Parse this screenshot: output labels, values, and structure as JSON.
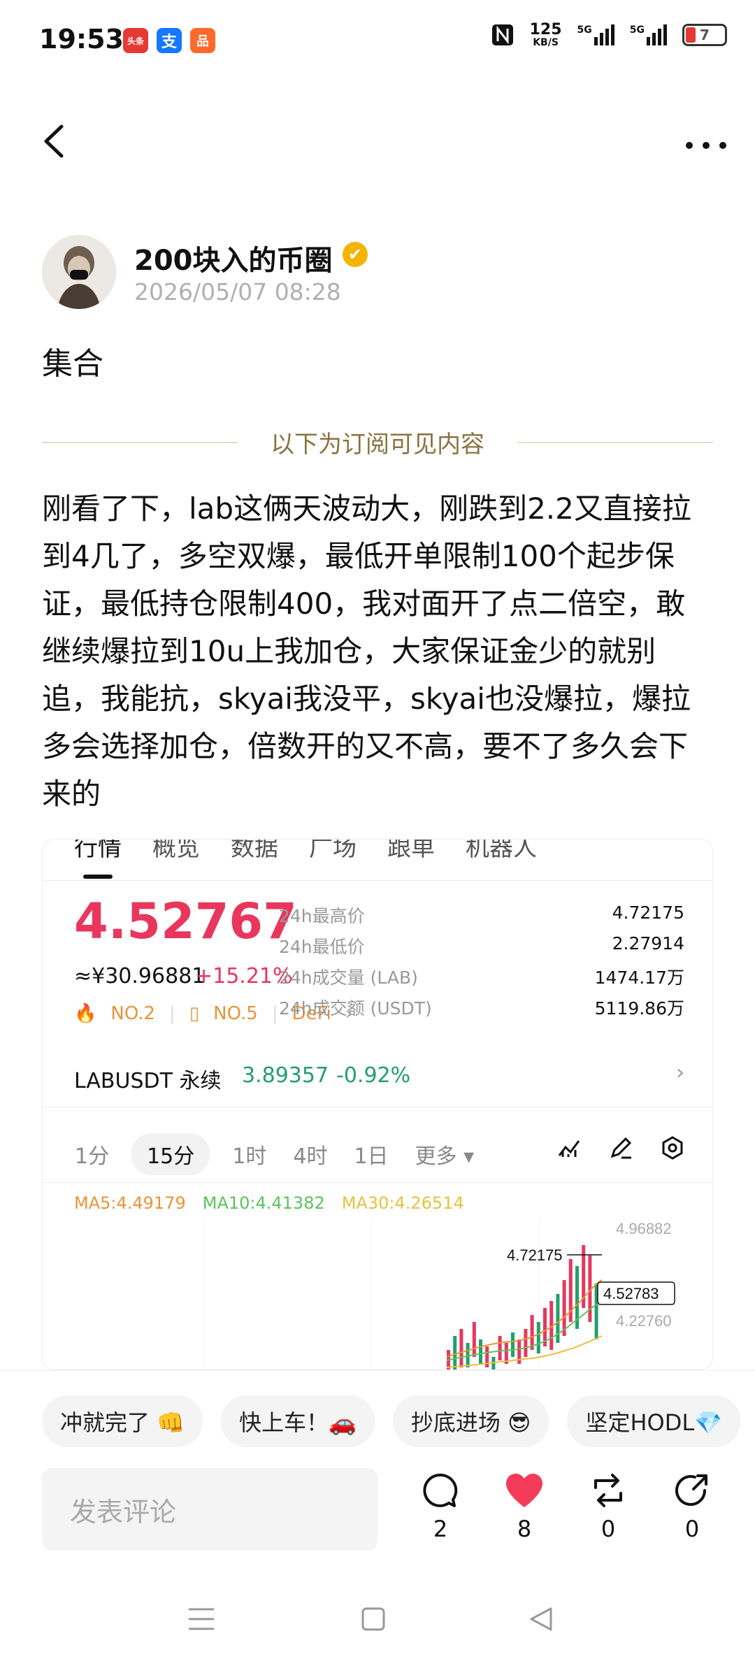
{
  "status": {
    "time": "19:53",
    "apps": [
      "头条",
      "支",
      "品"
    ],
    "net_speed_top": "125",
    "net_speed_unit": "KB/S",
    "sim1": "5G",
    "sim2": "5G",
    "battery": "7"
  },
  "post": {
    "author": "200块入的币圈",
    "date": "2026/05/07 08:28",
    "title": "集合",
    "subscription_divider": "以下为订阅可见内容",
    "body": "刚看了下，lab这俩天波动大，刚跌到2.2又直接拉到4几了，多空双爆，最低开单限制100个起步保证，最低持仓限制400，我对面开了点二倍空，敢继续爆拉到10u上我加仓，大家保证金少的就别追，我能抗，skyai我没平，skyai也没爆拉，爆拉多会选择加仓，倍数开的又不高，要不了多久会下来的"
  },
  "card": {
    "tabs": [
      "行情",
      "概览",
      "数据",
      "广场",
      "跟单",
      "机器人"
    ],
    "price": "4.52767",
    "cny": "≈¥30.96881",
    "change": "+15.21%",
    "tags": [
      "NO.2",
      "NO.5",
      "DeFi"
    ],
    "stats": [
      {
        "k": "24h最高价",
        "v": "4.72175"
      },
      {
        "k": "24h最低价",
        "v": "2.27914"
      },
      {
        "k": "24h成交量 (LAB)",
        "v": "1474.17万"
      },
      {
        "k": "24h成交额 (USDT)",
        "v": "5119.86万"
      }
    ],
    "perp_name": "LABUSDT 永续",
    "perp_price": "3.89357",
    "perp_change": "-0.92%",
    "intervals": [
      "1分",
      "15分",
      "1时",
      "4时",
      "1日",
      "更多"
    ],
    "ma5": "MA5:4.49179",
    "ma10": "MA10:4.41382",
    "ma30": "MA30:4.26514",
    "axis_top": "4.96882",
    "axis_mid": "4.22760",
    "peak_label": "4.72175",
    "last_label": "4.52783",
    "colors": {
      "up": "#e8365d",
      "down": "#21a06a",
      "ma5": "#e8943a",
      "ma10": "#5cc35c",
      "ma30": "#e8c040"
    }
  },
  "reactions": [
    "冲就完了 👊",
    "快上车！🚗",
    "抄底进场 😎",
    "坚定HODL💎"
  ],
  "comment_placeholder": "发表评论",
  "actions": {
    "comments": "2",
    "likes": "8",
    "reposts": "0",
    "shares": "0"
  }
}
